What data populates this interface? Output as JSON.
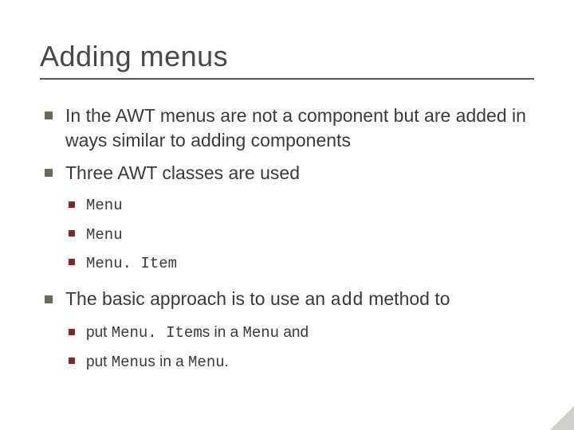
{
  "title": "Adding menus",
  "bullets": {
    "b1": "In the AWT menus are not a component but are added in ways similar to adding components",
    "b2": "Three AWT classes are used",
    "b2_sub": {
      "s1": "Menu",
      "s2": "Menu",
      "s3": "Menu. Item"
    },
    "b3_pre": "The basic approach is to use an ",
    "b3_code": "add",
    "b3_post": " method to",
    "b3_sub": {
      "s1_pre": "put ",
      "s1_code1": "Menu. Item",
      "s1_mid": "s in a ",
      "s1_code2": "Menu",
      "s1_post": " and",
      "s2_pre": "put ",
      "s2_code1": "Menu",
      "s2_mid": "s in a ",
      "s2_code2": "Menu",
      "s2_post": "."
    }
  }
}
